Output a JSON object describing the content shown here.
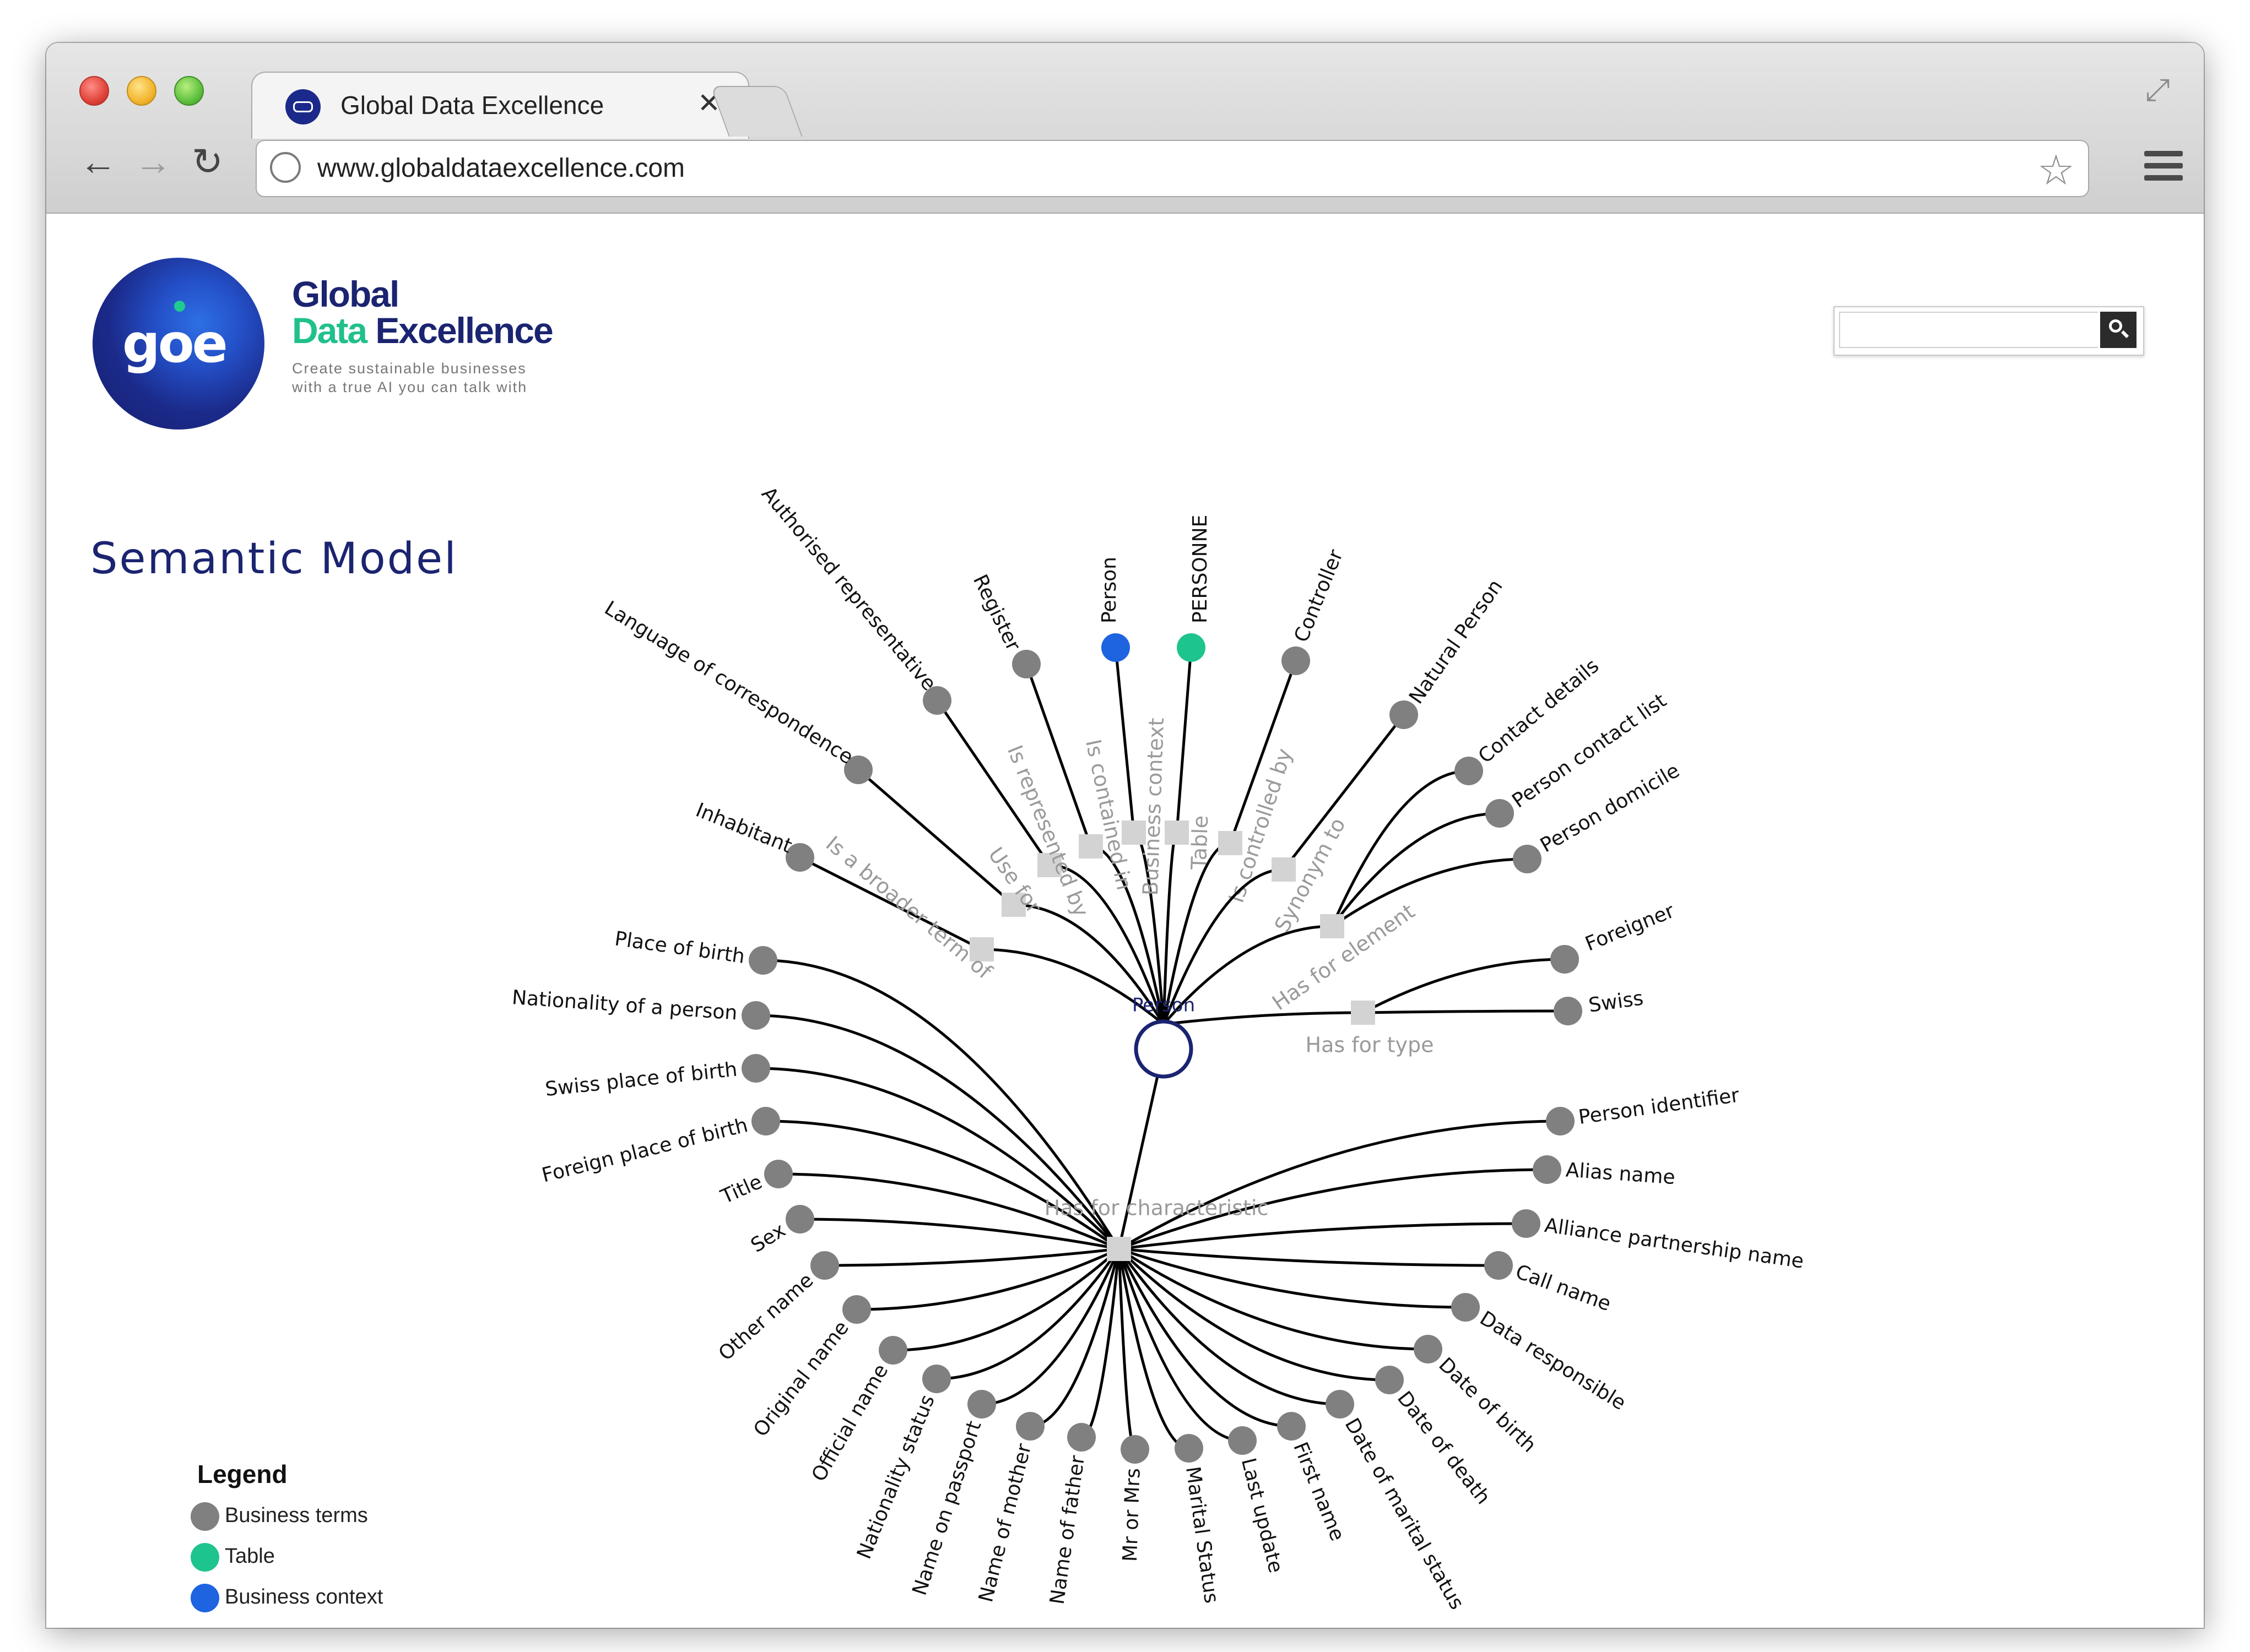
{
  "browser": {
    "tab_title": "Global Data Excellence",
    "tab_close": "✕",
    "url": "www.globaldataexcellence.com",
    "back_icon": "←",
    "forward_icon": "→",
    "reload_icon": "↻",
    "star_icon": "☆",
    "expand_icon": "⤢"
  },
  "brand": {
    "line1": "Global",
    "line2a": "Data",
    "line2b": "Excellence",
    "tagline1": "Create sustainable businesses",
    "tagline2": "with a true AI you can talk with",
    "logo_text": "goe"
  },
  "page": {
    "title": "Semantic Model"
  },
  "search": {
    "placeholder": ""
  },
  "colors": {
    "business_term": "#808080",
    "table": "#1ec48e",
    "business_context": "#1e63e0",
    "relation_box": "#d3d3d3",
    "edge": "#000000",
    "relation_text": "#9a9a9a",
    "title": "#1b2470"
  },
  "graph": {
    "center": "Person",
    "upper_relations": [
      {
        "label": "Is a broader term of",
        "targets": [
          {
            "name": "Inhabitant",
            "kind": "term"
          }
        ]
      },
      {
        "label": "Use for",
        "targets": [
          {
            "name": "Language of correspondence",
            "kind": "term"
          }
        ]
      },
      {
        "label": "Is represented by",
        "targets": [
          {
            "name": "Authorised representative",
            "kind": "term"
          }
        ]
      },
      {
        "label": "Is contained in",
        "targets": [
          {
            "name": "Register",
            "kind": "term"
          }
        ]
      },
      {
        "label": "Business context",
        "targets": [
          {
            "name": "Person",
            "kind": "context"
          }
        ]
      },
      {
        "label": "Table",
        "targets": [
          {
            "name": "PERSONNE",
            "kind": "table"
          }
        ]
      },
      {
        "label": "Is controlled by",
        "targets": [
          {
            "name": "Controller",
            "kind": "term"
          }
        ]
      },
      {
        "label": "Synonym to",
        "targets": [
          {
            "name": "Natural Person",
            "kind": "term"
          }
        ]
      },
      {
        "label": "Has for element",
        "targets": [
          {
            "name": "Contact details",
            "kind": "term"
          },
          {
            "name": "Person contact list",
            "kind": "term"
          },
          {
            "name": "Person domicile",
            "kind": "term"
          }
        ]
      },
      {
        "label": "Has for type",
        "targets": [
          {
            "name": "Foreigner",
            "kind": "term"
          },
          {
            "name": "Swiss",
            "kind": "term"
          }
        ]
      }
    ],
    "characteristic_relation": "Has for characteristic",
    "characteristics": [
      "Place of birth",
      "Nationality of a person",
      "Swiss place of birth",
      "Foreign place of birth",
      "Title",
      "Sex",
      "Other name",
      "Original name",
      "Official name",
      "Nationality status",
      "Name on passport",
      "Name of mother",
      "Name of father",
      "Mr or Mrs",
      "Marital Status",
      "Last update",
      "First name",
      "Date of marital status",
      "Date of death",
      "Date of birth",
      "Data responsible",
      "Call name",
      "Alliance partnership name",
      "Alias name",
      "Person identifier"
    ]
  },
  "legend": {
    "title": "Legend",
    "items": [
      {
        "label": "Business terms",
        "color": "#808080"
      },
      {
        "label": "Table",
        "color": "#1ec48e"
      },
      {
        "label": "Business context",
        "color": "#1e63e0"
      }
    ]
  }
}
